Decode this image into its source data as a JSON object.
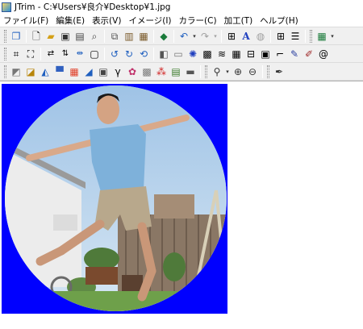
{
  "window": {
    "title": "JTrim - C:¥Users¥良介¥Desktop¥1.jpg"
  },
  "menu": [
    "ファイル(F)",
    "編集(E)",
    "表示(V)",
    "イメージ(I)",
    "カラー(C)",
    "加工(T)",
    "ヘルプ(H)"
  ],
  "colors": {
    "canvas_background": "#0000ff",
    "toolbar_background": "#f0f0f0"
  },
  "toolbar": {
    "row1": [
      "new-window-icon",
      "new-file-icon",
      "open-folder-icon",
      "save-icon",
      "print-icon",
      "print-preview-icon",
      "copy-icon",
      "paste-icon",
      "paste-new-icon",
      "capture-icon",
      "undo-icon",
      "redo-icon",
      "resize-icon",
      "text-icon",
      "sphere-icon",
      "grid-icon",
      "dash-line-icon",
      "palette-icon"
    ],
    "row2": [
      "crop-icon",
      "trim-icon",
      "flip-horizontal-icon",
      "flip-vertical-icon",
      "rotate-icon",
      "rotate-left-icon",
      "rotate-right-icon",
      "rotate-free-icon",
      "frame-icon",
      "shadow-icon",
      "blur-icon",
      "mosaic-icon",
      "wave-icon",
      "emboss-icon",
      "edge-icon",
      "brightness-icon",
      "pencil-icon",
      "brush-icon",
      "swirl-icon"
    ],
    "row3": [
      "monochrome-icon",
      "sepia-icon",
      "invert-icon",
      "gradient-icon",
      "rainbow-icon",
      "colorize-icon",
      "gamma-icon",
      "color-wheel-icon",
      "pattern-icon",
      "rgb-icon",
      "levels-icon",
      "stripe-icon",
      "zoom-icon",
      "zoom-in-icon",
      "zoom-out-icon",
      "eyedropper-icon"
    ]
  }
}
